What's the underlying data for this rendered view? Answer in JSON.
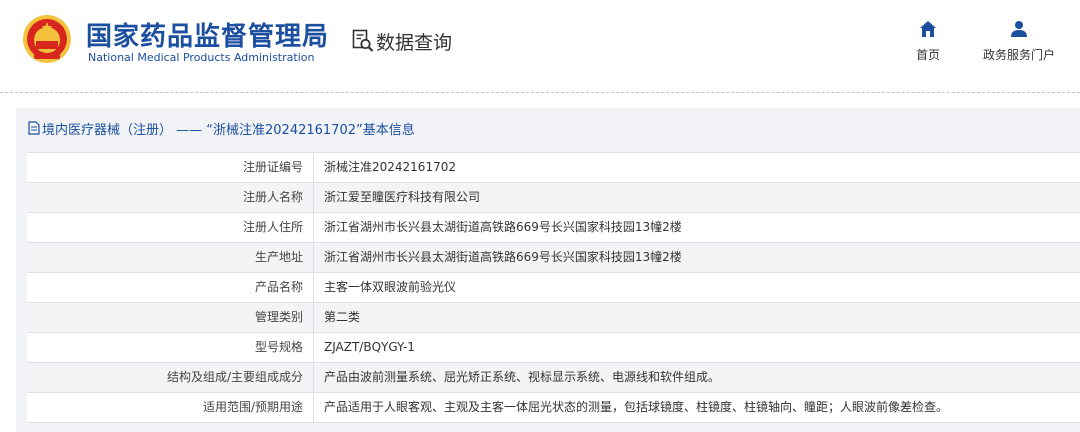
{
  "header": {
    "org_name_cn": "国家药品监督管理局",
    "org_name_en": "National Medical Products Administration",
    "query_label": "数据查询",
    "nav": [
      {
        "label": "首页",
        "icon": "home-icon"
      },
      {
        "label": "政务服务门户",
        "icon": "user-icon"
      }
    ]
  },
  "section": {
    "title": "境内医疗器械（注册） —— “浙械注准20242161702”基本信息"
  },
  "details": [
    {
      "label": "注册证编号",
      "value": "浙械注准20242161702"
    },
    {
      "label": "注册人名称",
      "value": "浙江爱至瞳医疗科技有限公司"
    },
    {
      "label": "注册人住所",
      "value": "浙江省湖州市长兴县太湖街道高铁路669号长兴国家科技园13幢2楼"
    },
    {
      "label": "生产地址",
      "value": "浙江省湖州市长兴县太湖街道高铁路669号长兴国家科技园13幢2楼"
    },
    {
      "label": "产品名称",
      "value": "主客一体双眼波前验光仪"
    },
    {
      "label": "管理类别",
      "value": "第二类"
    },
    {
      "label": "型号规格",
      "value": "ZJAZT/BQYGY-1"
    },
    {
      "label": "结构及组成/主要组成成分",
      "value": "产品由波前测量系统、屈光矫正系统、视标显示系统、电源线和软件组成。"
    },
    {
      "label": "适用范围/预期用途",
      "value": "产品适用于人眼客观、主观及主客一体屈光状态的测量，包括球镜度、柱镜度、柱镜轴向、瞳距；人眼波前像差检查。"
    }
  ],
  "colors": {
    "brand_blue": "#1c4fa0",
    "emblem_red": "#d7261e",
    "emblem_gold": "#f4c23c"
  }
}
